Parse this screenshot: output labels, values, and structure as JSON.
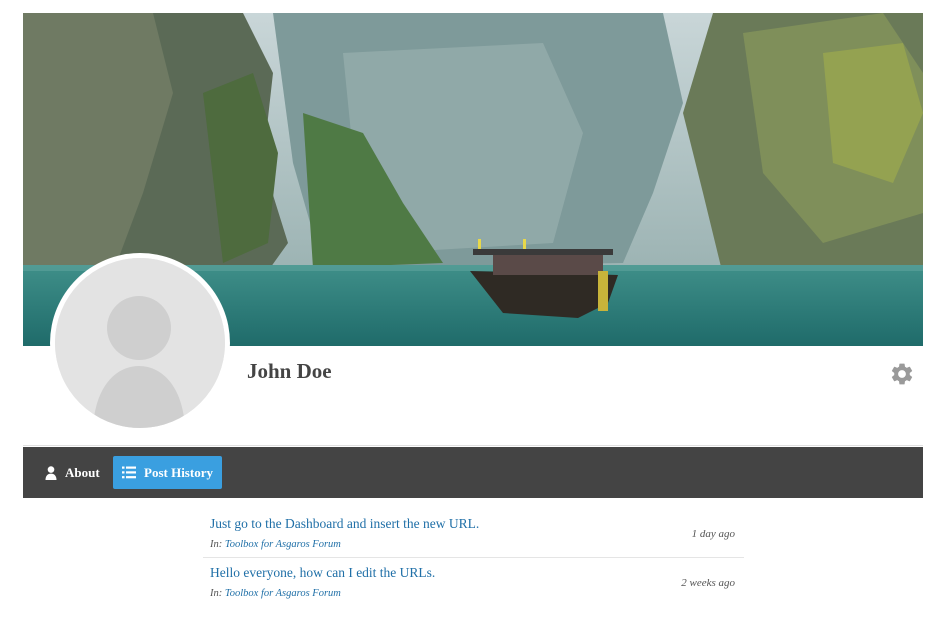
{
  "profile": {
    "name": "John Doe"
  },
  "nav": {
    "about_label": "About",
    "history_label": "Post History"
  },
  "posts": [
    {
      "title": "Just go to the Dashboard and insert the new URL.",
      "in_prefix": "In:",
      "forum": "Toolbox for Asgaros Forum",
      "date": "1 day ago"
    },
    {
      "title": "Hello everyone, how can I edit the URLs.",
      "in_prefix": "In:",
      "forum": "Toolbox for Asgaros Forum",
      "date": "2 weeks ago"
    }
  ],
  "colors": {
    "navbar": "#444444",
    "active_tab": "#3a9fe0",
    "link": "#1f6fa7"
  },
  "icons": {
    "settings": "gear-icon",
    "about": "user-icon",
    "history": "list-icon"
  }
}
